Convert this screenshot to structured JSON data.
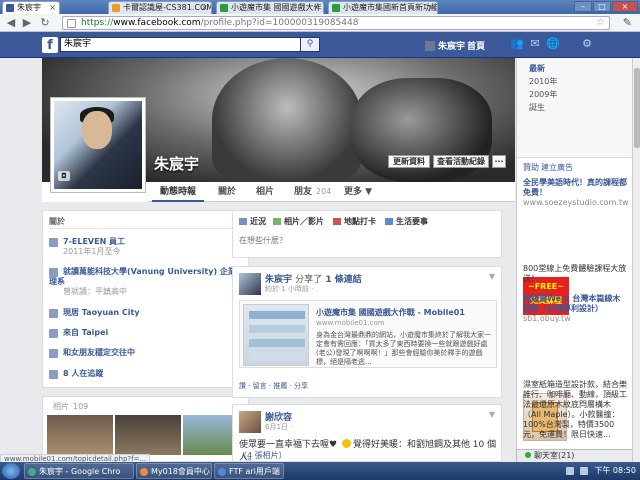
{
  "browser": {
    "tabs": [
      {
        "label": "朱宸宇",
        "active": true
      },
      {
        "label": "卡爾認識屋-CS381.COM",
        "active": false
      },
      {
        "label": "小遊魔市集 國國遊戲大作",
        "active": false
      },
      {
        "label": "小遊魔市集國新首頁新功能",
        "active": false
      }
    ],
    "url_host": "www.facebook.com",
    "url_path": "/profile.php?id=100000319085448",
    "url_scheme": "https://"
  },
  "fb_bar": {
    "logo": "f",
    "search_value": "朱宸宇",
    "user_name": "朱宸宇",
    "home_label": "首頁"
  },
  "profile": {
    "name": "朱宸宇",
    "update_info_button": "更新資料",
    "activity_log_button": "查看活動紀錄",
    "more_options": "···",
    "tabs": [
      {
        "label": "動態時報",
        "selected": true
      },
      {
        "label": "關於"
      },
      {
        "label": "相片"
      },
      {
        "label": "朋友",
        "count": "204"
      },
      {
        "label": "更多 ▼"
      }
    ]
  },
  "timeline_years": [
    "最新",
    "2010年",
    "2009年",
    "誕生"
  ],
  "about": {
    "header": "關於",
    "items": [
      {
        "title": "7-ELEVEN 員工",
        "sub": "2011年1月至今"
      },
      {
        "title": "就讀萬能科技大學(Vanung University) 企業管理系",
        "sub": "曾就讀：平鎮高中"
      },
      {
        "title": "現居 Taoyuan City",
        "sub": ""
      },
      {
        "title": "來自 Taipei",
        "sub": ""
      },
      {
        "title": "和女朋友穩定交往中",
        "sub": ""
      },
      {
        "title": "8 人在追蹤",
        "sub": ""
      }
    ]
  },
  "photos": {
    "header": "相片",
    "count": "109"
  },
  "composer": {
    "actions": [
      "近況",
      "相片／影片",
      "地點打卡",
      "生活要事"
    ],
    "placeholder": "在想些什麼？"
  },
  "post1": {
    "author": "朱宸宇",
    "verb": "分享了",
    "link_word": "1 條連結",
    "time": "約於 1 小時前 ·",
    "link_title": "小遊魔市集 國國遊戲大作戰 - Mobile01",
    "link_url": "www.mobile01.com",
    "link_desc": "身為金台灣最鼎鼎的網站，小遊魔市集終於了解我大家一定會有需回應：「買太多了東西時要換一些就跟遊戲好處(老公)發現了啊啊啊！」那些會經驗你美於釋手的遊戲標，絕是隔老逃...",
    "actions": "讚 · 留言 · 推薦 · 分享"
  },
  "post2": {
    "author": "謝欣容",
    "time": "6月1日 ·",
    "text_pre": "使眾要一直幸福下去喔♥ ",
    "text_post": "覺得好美暖：和劉旭鋼及其他 10 個人。",
    "count": "（4 張相片）"
  },
  "sidebar": {
    "sponsor_header": "贊助",
    "sponsor_link": "建立廣告",
    "ads": [
      {
        "title": "全民學美語時代！真的課程都免費！",
        "url": "www.soezeystudio.com.tw",
        "body": ""
      },
      {
        "title": "",
        "url": "",
        "body": "800堂線上免費體驗課程大放送！"
      },
      {
        "title": "超級賣West 台灣本篇線木蒜鹿（台灣專利設計）",
        "url": "sb1.obuy.tw",
        "body": "濕室紙箱造型設計款，結合樂誰行、咖啡廳、動線，頂級工法最還原木紋底閂層構木（All Maple）。小款醫撞：100%台灣製，特價3500元，免運費！限日快速..."
      }
    ],
    "ad1_image_text": "~FREE~\n免費課程",
    "chat_label": "聊天室(21)"
  },
  "status_bar": "www.mobile01.com/topicdetail.php?f=...",
  "taskbar": {
    "items": [
      "朱宸宇 - Google Chro",
      "My018會員中心 - 工",
      "FTF ari用戶端"
    ],
    "clock": "下午 08:50"
  }
}
